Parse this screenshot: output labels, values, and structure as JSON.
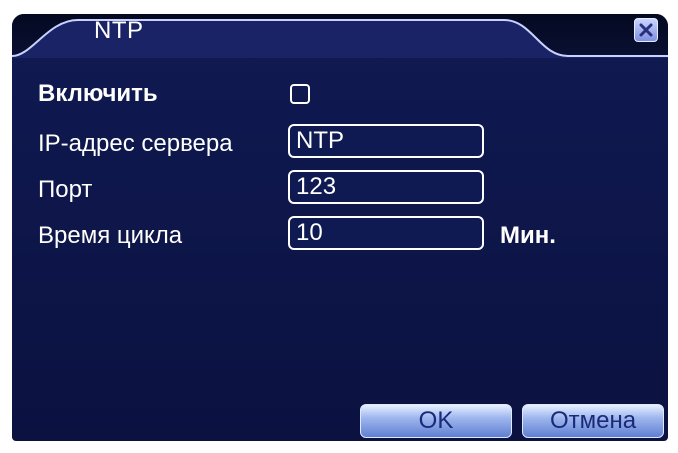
{
  "dialog": {
    "title": "NTP"
  },
  "form": {
    "enable_label": "Включить",
    "enable_checked": false,
    "server_label": "IP-адрес сервера",
    "server_value": "NTP",
    "port_label": "Порт",
    "port_value": "123",
    "cycle_label": "Время цикла",
    "cycle_value": "10",
    "cycle_unit": "Мин."
  },
  "buttons": {
    "ok_label": "OK",
    "cancel_label": "Отмена"
  },
  "icons": {
    "close": "close-icon"
  },
  "colors": {
    "background": "#0d1548",
    "text": "#ffffff",
    "button_text": "#1a2a78"
  }
}
